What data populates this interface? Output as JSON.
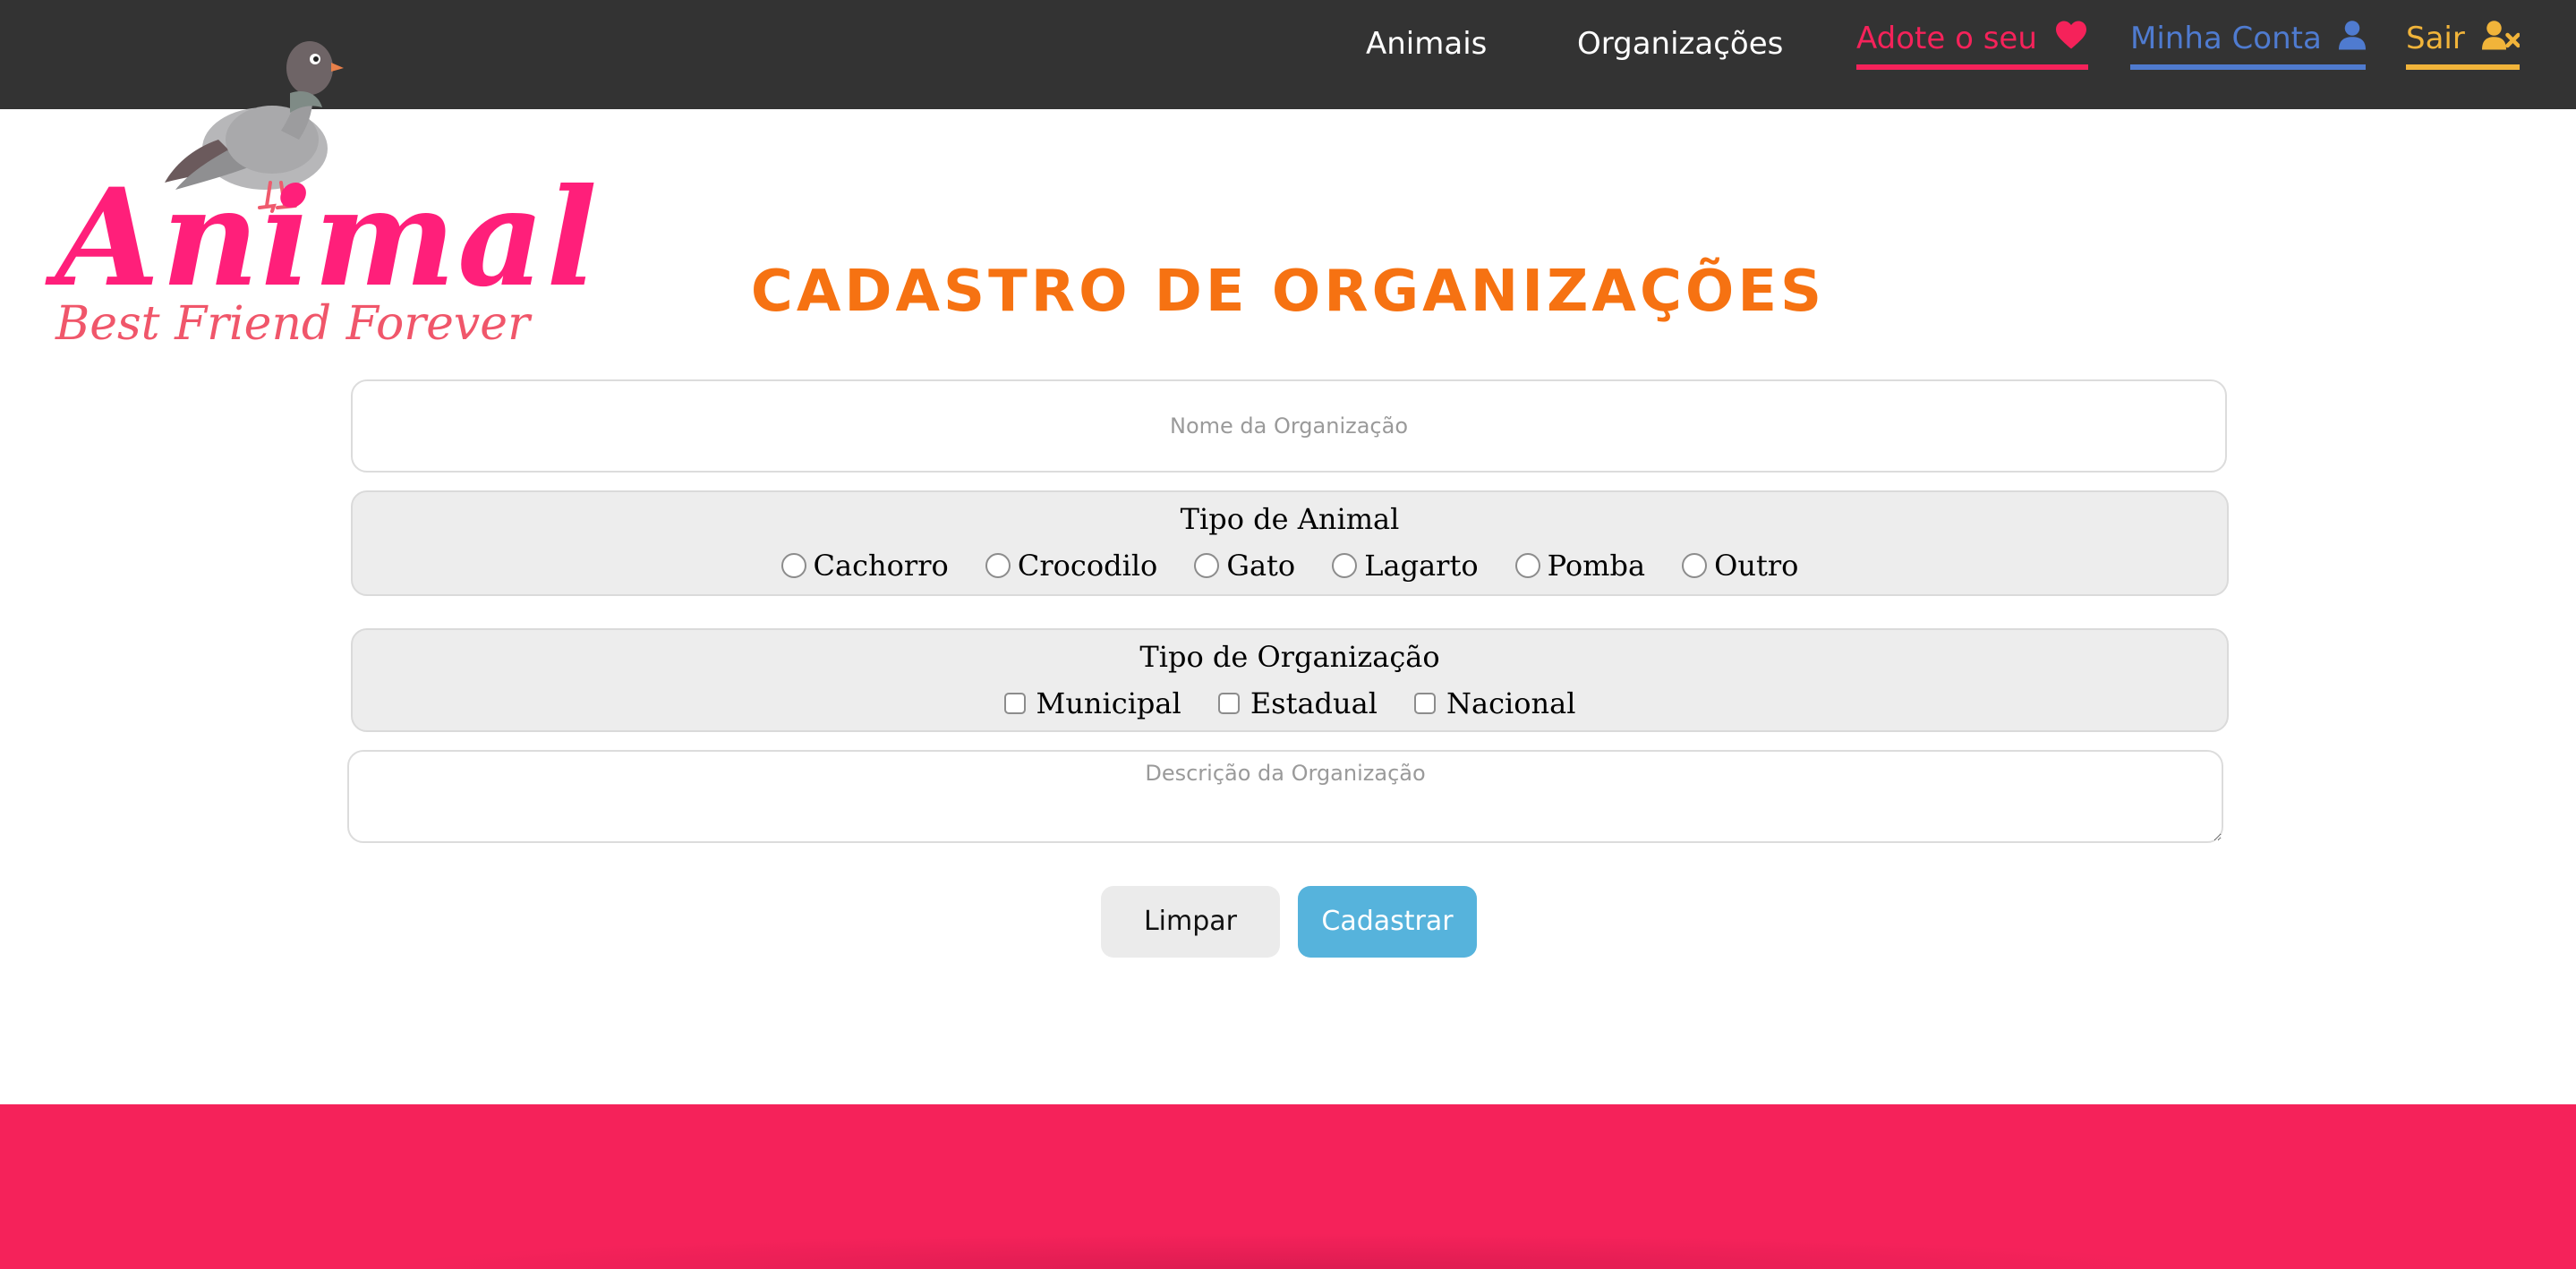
{
  "nav": {
    "items": [
      {
        "label": "Animais"
      },
      {
        "label": "Organizações"
      },
      {
        "label": "Adote o seu",
        "icon": "heart-icon",
        "color": "#f5225a"
      },
      {
        "label": "Minha Conta",
        "icon": "user-icon",
        "color": "#4f7bd0"
      },
      {
        "label": "Sair",
        "icon": "user-remove-icon",
        "color": "#f1b43a"
      }
    ],
    "bar_color": "#333333"
  },
  "logo": {
    "word": "Animal",
    "tagline": "Best Friend Forever",
    "mascot": "pigeon-icon"
  },
  "page": {
    "title": "CADASTRO DE ORGANIZAÇÕES",
    "title_color": "#f67212"
  },
  "form": {
    "name_placeholder": "Nome da Organização",
    "animal_type": {
      "legend": "Tipo de Animal",
      "options": [
        "Cachorro",
        "Crocodilo",
        "Gato",
        "Lagarto",
        "Pomba",
        "Outro"
      ]
    },
    "org_type": {
      "legend": "Tipo de Organização",
      "options": [
        "Municipal",
        "Estadual",
        "Nacional"
      ]
    },
    "description_placeholder": "Descrição da Organização",
    "clear_label": "Limpar",
    "submit_label": "Cadastrar",
    "submit_color": "#56b3dc"
  },
  "footer": {
    "color": "#f5225a"
  }
}
